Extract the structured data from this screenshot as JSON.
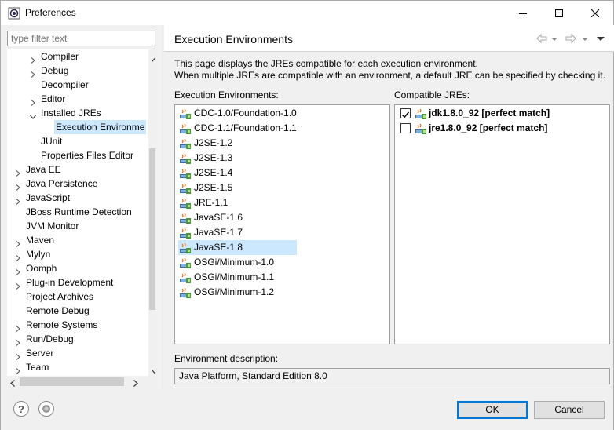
{
  "window": {
    "title": "Preferences"
  },
  "filter": {
    "placeholder": "type filter text"
  },
  "tree": {
    "items": [
      {
        "label": "Compiler",
        "expander": "collapsed"
      },
      {
        "label": "Debug",
        "expander": "collapsed"
      },
      {
        "label": "Decompiler",
        "expander": "none"
      },
      {
        "label": "Editor",
        "expander": "collapsed"
      },
      {
        "label": "Installed JREs",
        "expander": "expanded"
      },
      {
        "label": "Execution Environme",
        "expander": "none",
        "selected": true
      },
      {
        "label": "JUnit",
        "expander": "none"
      },
      {
        "label": "Properties Files Editor",
        "expander": "none"
      },
      {
        "label": "Java EE",
        "expander": "collapsed"
      },
      {
        "label": "Java Persistence",
        "expander": "collapsed"
      },
      {
        "label": "JavaScript",
        "expander": "collapsed"
      },
      {
        "label": "JBoss Runtime Detection",
        "expander": "none"
      },
      {
        "label": "JVM Monitor",
        "expander": "none"
      },
      {
        "label": "Maven",
        "expander": "collapsed"
      },
      {
        "label": "Mylyn",
        "expander": "collapsed"
      },
      {
        "label": "Oomph",
        "expander": "collapsed"
      },
      {
        "label": "Plug-in Development",
        "expander": "collapsed"
      },
      {
        "label": "Project Archives",
        "expander": "none"
      },
      {
        "label": "Remote Debug",
        "expander": "none"
      },
      {
        "label": "Remote Systems",
        "expander": "collapsed"
      },
      {
        "label": "Run/Debug",
        "expander": "collapsed"
      },
      {
        "label": "Server",
        "expander": "collapsed"
      },
      {
        "label": "Team",
        "expander": "collapsed"
      }
    ]
  },
  "page": {
    "title": "Execution Environments",
    "description_line1": "This page displays the JREs compatible for each execution environment.",
    "description_line2": "When multiple JREs are compatible with an environment, a default JRE can be specified by checking it.",
    "env_label": "Execution Environments:",
    "jre_label": "Compatible JREs:",
    "environments": [
      {
        "label": "CDC-1.0/Foundation-1.0"
      },
      {
        "label": "CDC-1.1/Foundation-1.1"
      },
      {
        "label": "J2SE-1.2"
      },
      {
        "label": "J2SE-1.3"
      },
      {
        "label": "J2SE-1.4"
      },
      {
        "label": "J2SE-1.5"
      },
      {
        "label": "JRE-1.1"
      },
      {
        "label": "JavaSE-1.6"
      },
      {
        "label": "JavaSE-1.7"
      },
      {
        "label": "JavaSE-1.8",
        "selected": true
      },
      {
        "label": "OSGi/Minimum-1.0"
      },
      {
        "label": "OSGi/Minimum-1.1"
      },
      {
        "label": "OSGi/Minimum-1.2"
      }
    ],
    "jres": [
      {
        "label": "jdk1.8.0_92 [perfect match]",
        "checked": true
      },
      {
        "label": "jre1.8.0_92 [perfect match]",
        "checked": false
      }
    ],
    "env_desc_label": "Environment description:",
    "env_desc_value": "Java Platform, Standard Edition 8.0"
  },
  "buttons": {
    "ok": "OK",
    "cancel": "Cancel",
    "help_glyph": "?"
  },
  "colors": {
    "selection": "#cce8ff",
    "accent": "#0078d7"
  }
}
